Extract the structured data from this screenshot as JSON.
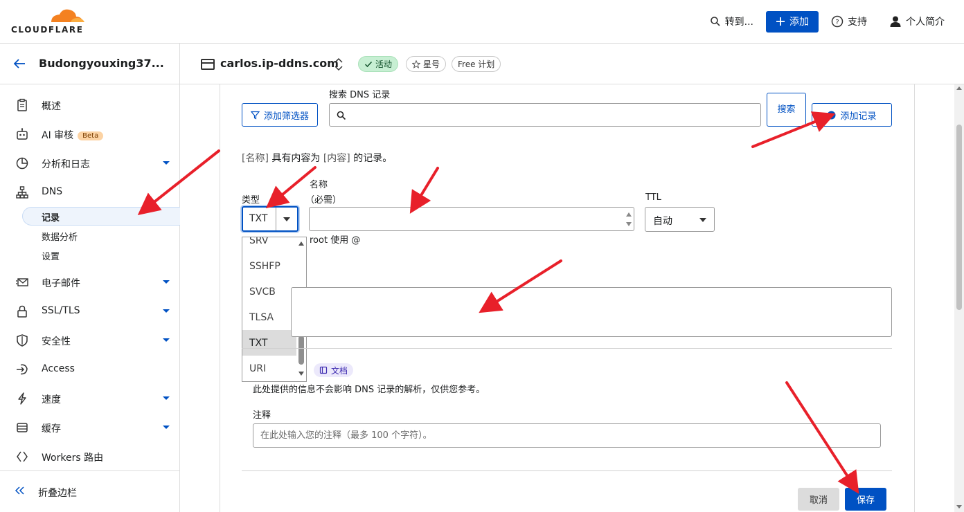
{
  "brand": {
    "logo_text": "CLOUDFLARE",
    "orange": "#f48120",
    "accent": "#0051c3"
  },
  "topbar": {
    "goto_label": "转到...",
    "add_label": "添加",
    "support_label": "支持",
    "profile_label": "个人简介"
  },
  "sidebar": {
    "account_name": "Budongyouxing37...",
    "items": [
      {
        "label": "概述",
        "icon": "document-icon"
      },
      {
        "label": "AI 审核",
        "icon": "robot-icon",
        "badge": "Beta"
      },
      {
        "label": "分析和日志",
        "icon": "pie-chart-icon"
      },
      {
        "label": "DNS",
        "icon": "network-icon"
      },
      {
        "label": "电子邮件",
        "icon": "envelope-icon"
      },
      {
        "label": "SSL/TLS",
        "icon": "lock-icon"
      },
      {
        "label": "安全性",
        "icon": "shield-icon"
      },
      {
        "label": "Access",
        "icon": "access-icon"
      },
      {
        "label": "速度",
        "icon": "bolt-icon"
      },
      {
        "label": "缓存",
        "icon": "cache-icon"
      },
      {
        "label": "Workers 路由",
        "icon": "workers-icon"
      }
    ],
    "dns_sub": [
      "记录",
      "数据分析",
      "设置"
    ],
    "collapse_label": "折叠边栏"
  },
  "zone": {
    "name": "carlos.ip-ddns.com",
    "status": "活动",
    "star": "星号",
    "plan": "Free 计划"
  },
  "dns": {
    "filter_button": "添加筛选器",
    "search_label": "搜索 DNS 记录",
    "search_placeholder": "",
    "search_button": "搜索",
    "add_record_button": "添加记录",
    "hint": {
      "name_token": "[名称]",
      "mid": " 具有内容为 ",
      "content_token": "[内容]",
      "end": " 的记录。"
    },
    "type_label": "类型",
    "type_value": "TXT",
    "type_options": [
      "SRV",
      "SSHFP",
      "SVCB",
      "TLSA",
      "TXT",
      "URI"
    ],
    "name_label_1": "名称",
    "name_label_2": "（必需）",
    "name_value": "",
    "name_hint": "root 使用 @",
    "ttl_label": "TTL",
    "ttl_value": "自动",
    "content_value": "",
    "doc_label": "文档",
    "info_text": "此处提供的信息不会影响 DNS 记录的解析，仅供您参考。",
    "comment_label": "注释",
    "comment_placeholder": "在此处输入您的注释（最多 100 个字符）。",
    "cancel_button": "取消",
    "save_button": "保存"
  }
}
